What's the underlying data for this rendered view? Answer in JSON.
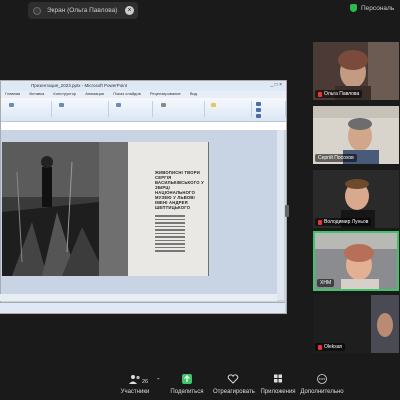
{
  "top_bar": {
    "share_label": "Экран (Ольга Павлова)",
    "close_glyph": "×",
    "view_label": "Персональ"
  },
  "shared_window": {
    "title": "Презентация_2023.pptx - Microsoft PowerPoint",
    "tabs": [
      "Главная",
      "Вставка",
      "Конструктор",
      "Анимация",
      "Показ слайдов",
      "Рецензирование",
      "Вид"
    ],
    "ribbon_groups": [
      "Буфер обмена",
      "Слайды",
      "Шрифт",
      "Абзац",
      "Рисование",
      "Редактирование"
    ],
    "ribbon_items": [
      "Найти",
      "Заменить",
      "Выделить",
      "Упорядочить",
      "Экспресс-стили"
    ],
    "window_controls": "_ □ ×"
  },
  "slide": {
    "article_title": "ЖИВОПИСНІ ТВОРИ СЕРГІЯ ВАСИЛЬКІВСЬКОГО У ЗБІРЦІ НАЦІОНАЛЬНОГО МУЗЕЮ У ЛЬВОВІ ІМЕНІ АНДРЕЯ ШЕПТИЦЬКОГО"
  },
  "participants": [
    {
      "name": "Ольга Павлова",
      "muted": true
    },
    {
      "name": "Сергій Посохов",
      "muted": false
    },
    {
      "name": "Володимир Луньов",
      "muted": true
    },
    {
      "name": "ХНМ",
      "muted": false
    },
    {
      "name": "Oleksan",
      "muted": true
    }
  ],
  "toolbar": {
    "participants_label": "Участники",
    "participants_count": "26",
    "share_label": "Поделиться",
    "react_label": "Отреагировать",
    "apps_label": "Приложения",
    "more_label": "Дополнительно"
  },
  "colors": {
    "share_green": "#3fc46a",
    "mute_red": "#e33333",
    "background": "#1a1a1a"
  }
}
